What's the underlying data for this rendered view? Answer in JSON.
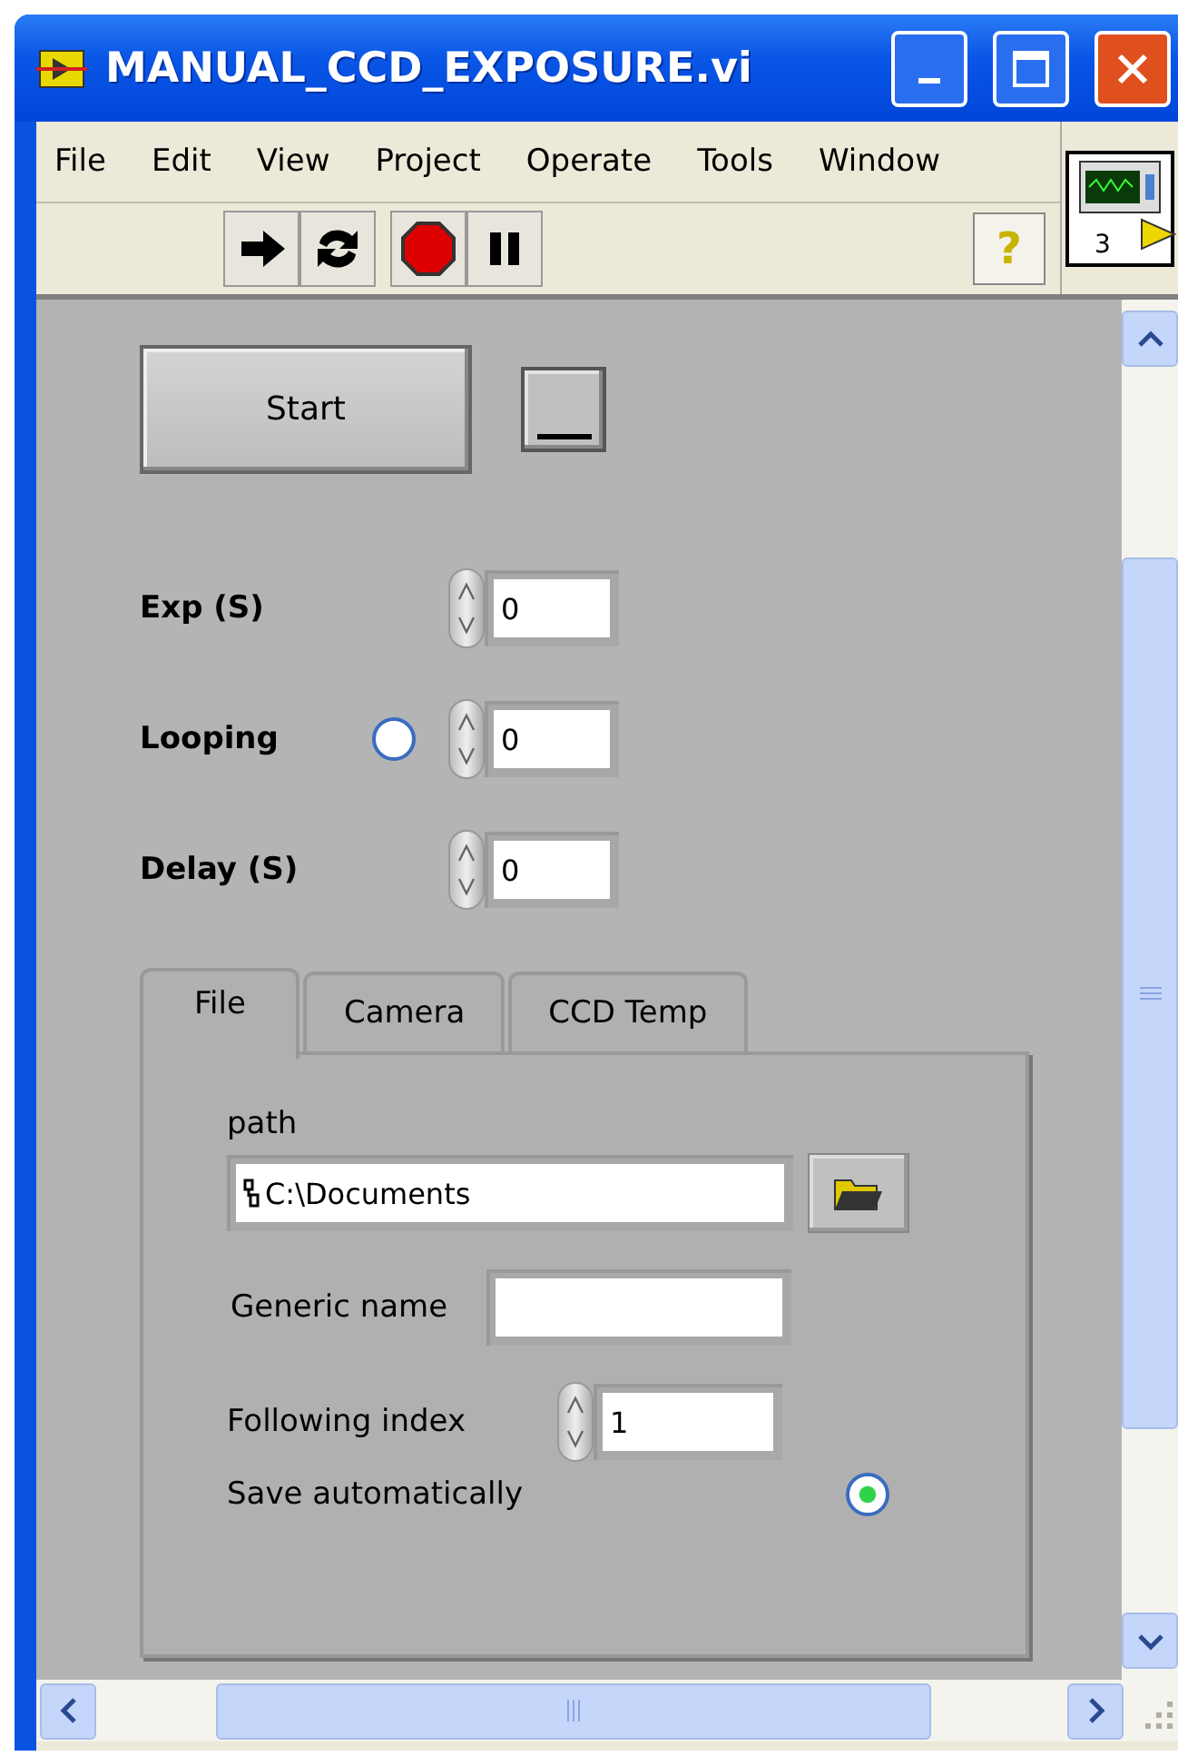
{
  "window": {
    "title": "MANUAL_CCD_EXPOSURE.vi"
  },
  "menus": [
    "File",
    "Edit",
    "View",
    "Project",
    "Operate",
    "Tools",
    "Window"
  ],
  "toolbar": {
    "help_label": "?"
  },
  "connector": {
    "label": "3"
  },
  "start_button": {
    "label": "Start"
  },
  "controls": [
    {
      "kind": "numeric",
      "label": "Exp (S)",
      "value": "0"
    },
    {
      "kind": "numeric_led",
      "label": "Looping",
      "value": "0",
      "on": false
    },
    {
      "kind": "numeric",
      "label": "Delay (S)",
      "value": "0"
    }
  ],
  "tabs": [
    {
      "label": "File",
      "selected": true
    },
    {
      "label": "Camera",
      "selected": false
    },
    {
      "label": "CCD Temp",
      "selected": false
    }
  ],
  "file_tab": {
    "path_label": "path",
    "path_value": "C:\\Documents",
    "generic_name_label": "Generic name",
    "following_index_label": "Following index",
    "following_index_value": "1",
    "save_label": "Save automatically",
    "save_on": true
  }
}
